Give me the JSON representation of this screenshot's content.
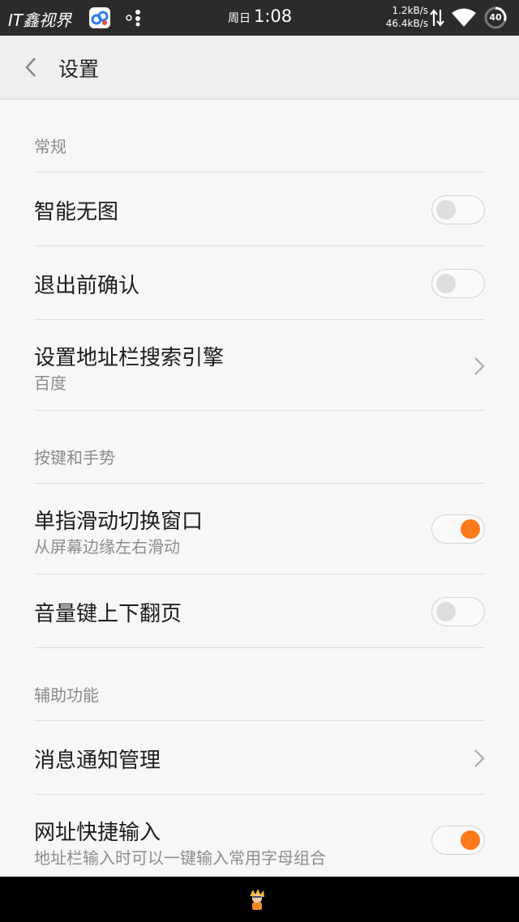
{
  "statusbar": {
    "brand": "IT鑫视界",
    "day": "周日",
    "time": "1:08",
    "upload_speed": "1.2kB/s",
    "download_speed": "46.4kB/s",
    "battery": "40",
    "icons": [
      "app-icon",
      "dots-icon",
      "data-arrows-icon",
      "wifi-icon",
      "battery-icon"
    ]
  },
  "header": {
    "title": "设置",
    "back_icon": "chevron-left-icon"
  },
  "sections": [
    {
      "title": "常规",
      "items": [
        {
          "title": "智能无图",
          "type": "toggle",
          "on": false
        },
        {
          "title": "退出前确认",
          "type": "toggle",
          "on": false
        },
        {
          "title": "设置地址栏搜索引擎",
          "subtitle": "百度",
          "type": "link"
        }
      ]
    },
    {
      "title": "按键和手势",
      "items": [
        {
          "title": "单指滑动切换窗口",
          "subtitle": "从屏幕边缘左右滑动",
          "type": "toggle",
          "on": true
        },
        {
          "title": "音量键上下翻页",
          "type": "toggle",
          "on": false
        }
      ]
    },
    {
      "title": "辅助功能",
      "items": [
        {
          "title": "消息通知管理",
          "type": "link"
        },
        {
          "title": "网址快捷输入",
          "subtitle": "地址栏输入时可以一键输入常用字母组合",
          "type": "toggle",
          "on": true
        }
      ]
    }
  ],
  "colors": {
    "accent": "#ff7a1a",
    "background": "#f7f7f7",
    "header": "#efefef",
    "statusbar": "#2b2b2b"
  }
}
